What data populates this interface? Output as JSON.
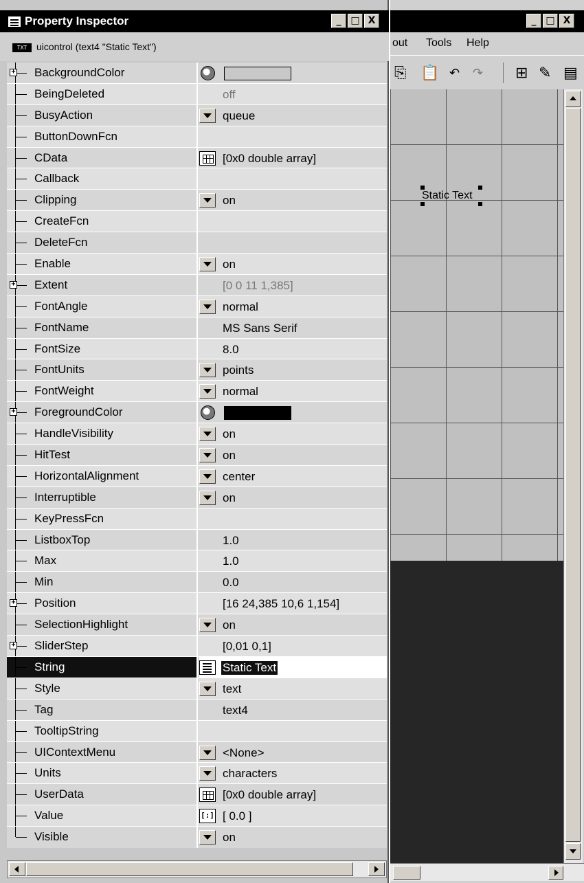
{
  "inspector": {
    "title": "Property Inspector",
    "object_tag": "TXT",
    "object_label": "uicontrol (text4 \"Static Text\")",
    "window_buttons": [
      "_",
      "□",
      "X"
    ],
    "rows": [
      {
        "name": "BackgroundColor",
        "expand": true,
        "control": "color",
        "value": "",
        "swatch": "#c8c8c8"
      },
      {
        "name": "BeingDeleted",
        "control": "",
        "value": "off",
        "gray": true
      },
      {
        "name": "BusyAction",
        "control": "dropdown",
        "value": "queue"
      },
      {
        "name": "ButtonDownFcn",
        "control": "",
        "value": ""
      },
      {
        "name": "CData",
        "control": "grid",
        "value": "[0x0  double array]"
      },
      {
        "name": "Callback",
        "control": "",
        "value": ""
      },
      {
        "name": "Clipping",
        "control": "dropdown",
        "value": "on"
      },
      {
        "name": "CreateFcn",
        "control": "",
        "value": ""
      },
      {
        "name": "DeleteFcn",
        "control": "",
        "value": ""
      },
      {
        "name": "Enable",
        "control": "dropdown",
        "value": "on"
      },
      {
        "name": "Extent",
        "expand": true,
        "control": "",
        "value": "[0 0 11 1,385]",
        "gray": true
      },
      {
        "name": "FontAngle",
        "control": "dropdown",
        "value": "normal"
      },
      {
        "name": "FontName",
        "control": "",
        "value": "MS Sans Serif"
      },
      {
        "name": "FontSize",
        "control": "",
        "value": "8.0"
      },
      {
        "name": "FontUnits",
        "control": "dropdown",
        "value": "points"
      },
      {
        "name": "FontWeight",
        "control": "dropdown",
        "value": "normal"
      },
      {
        "name": "ForegroundColor",
        "expand": true,
        "control": "color",
        "value": "",
        "swatch": "#000000"
      },
      {
        "name": "HandleVisibility",
        "control": "dropdown",
        "value": "on"
      },
      {
        "name": "HitTest",
        "control": "dropdown",
        "value": "on"
      },
      {
        "name": "HorizontalAlignment",
        "control": "dropdown",
        "value": "center"
      },
      {
        "name": "Interruptible",
        "control": "dropdown",
        "value": "on"
      },
      {
        "name": "KeyPressFcn",
        "control": "",
        "value": ""
      },
      {
        "name": "ListboxTop",
        "control": "",
        "value": "1.0"
      },
      {
        "name": "Max",
        "control": "",
        "value": "1.0"
      },
      {
        "name": "Min",
        "control": "",
        "value": "0.0"
      },
      {
        "name": "Position",
        "expand": true,
        "control": "",
        "value": "[16 24,385 10,6 1,154]"
      },
      {
        "name": "SelectionHighlight",
        "control": "dropdown",
        "value": "on"
      },
      {
        "name": "SliderStep",
        "expand": true,
        "control": "",
        "value": "[0,01 0,1]"
      },
      {
        "name": "String",
        "control": "text",
        "value": "Static Text",
        "selected": true
      },
      {
        "name": "Style",
        "control": "dropdown",
        "value": "text"
      },
      {
        "name": "Tag",
        "control": "",
        "value": "text4"
      },
      {
        "name": "TooltipString",
        "control": "",
        "value": ""
      },
      {
        "name": "UIContextMenu",
        "control": "dropdown",
        "value": "<None>"
      },
      {
        "name": "Units",
        "control": "dropdown",
        "value": "characters"
      },
      {
        "name": "UserData",
        "control": "grid",
        "value": "[0x0  double array]"
      },
      {
        "name": "Value",
        "control": "array",
        "value": "[ 0.0 ]"
      },
      {
        "name": "Visible",
        "control": "dropdown",
        "value": "on"
      }
    ]
  },
  "guide": {
    "menu": [
      "out",
      "Tools",
      "Help"
    ],
    "toolbar_icons": [
      "copy-icon",
      "paste-icon",
      "undo-icon",
      "redo-icon",
      "align-icon",
      "property-editor-icon",
      "object-browser-icon"
    ],
    "static_text": "Static Text",
    "window_buttons": [
      "_",
      "□",
      "X"
    ]
  }
}
